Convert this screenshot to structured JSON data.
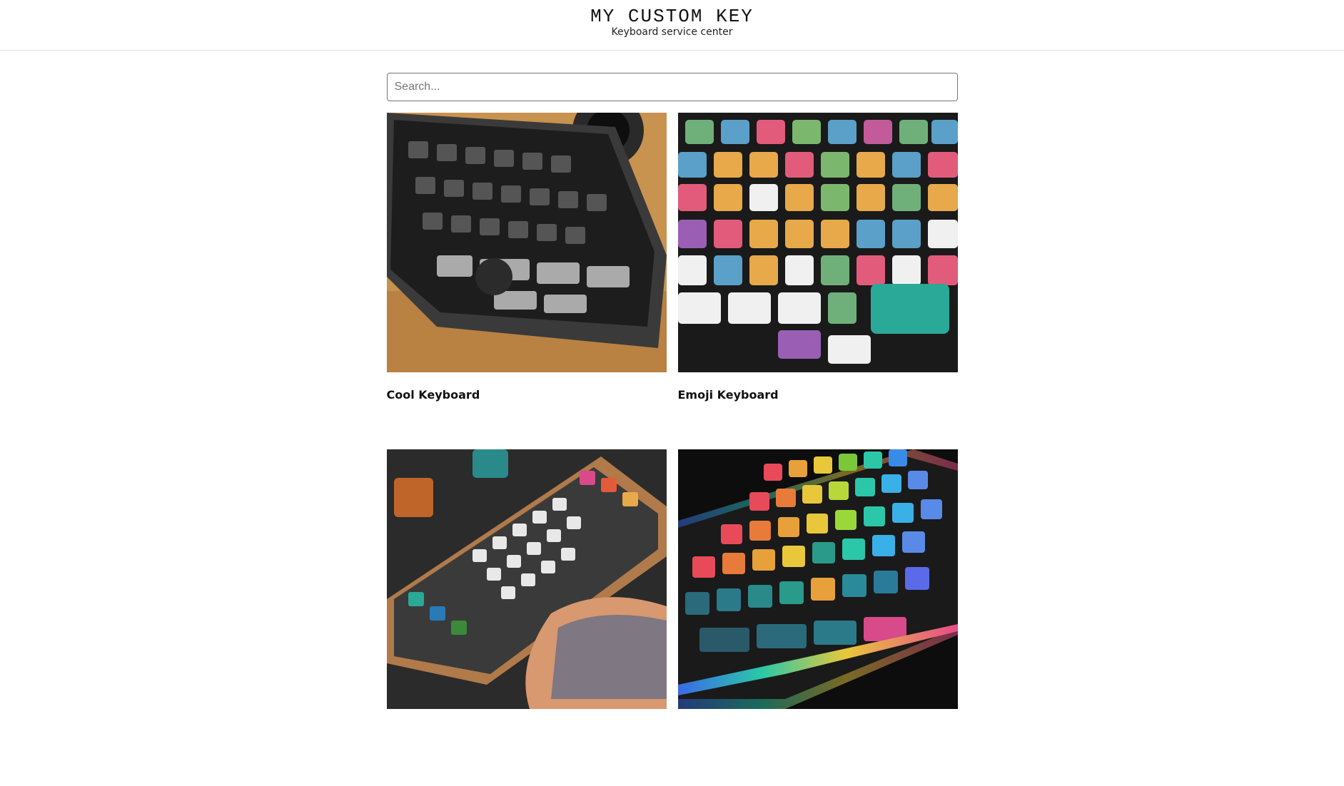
{
  "header": {
    "brand": "MY CUSTOM KEY",
    "tagline": "Keyboard service center"
  },
  "search": {
    "placeholder": "Search...",
    "value": ""
  },
  "products": [
    {
      "title": "Cool Keyboard",
      "image": "black-gray-keyboard-with-dragon-keycaps-photo"
    },
    {
      "title": "Emoji Keyboard",
      "image": "colorful-emoji-keycaps-keyboard-photo"
    },
    {
      "title": "",
      "image": "wooden-case-artisan-keyboard-photo"
    },
    {
      "title": "",
      "image": "rgb-translucent-keycaps-keyboard-photo"
    }
  ],
  "colors": {
    "border": "#e6e6e6",
    "text": "#111111"
  }
}
